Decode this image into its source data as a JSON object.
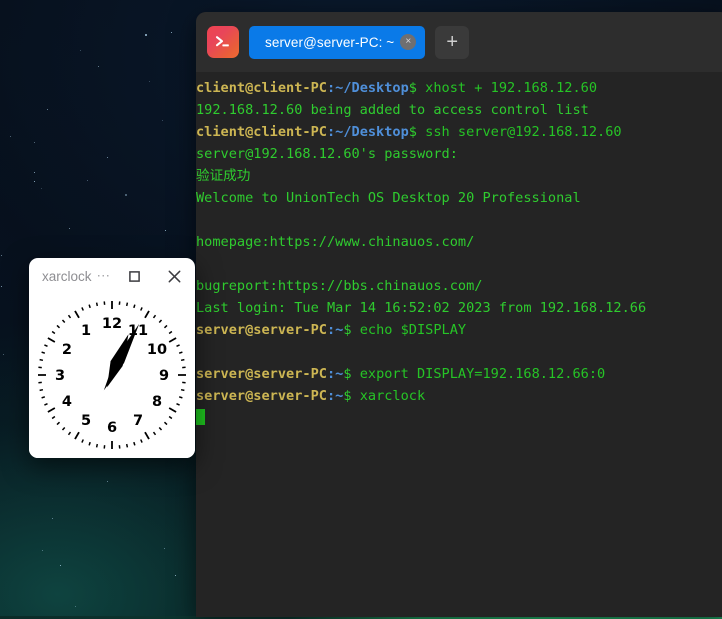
{
  "desktop": {
    "wallpaper_name": "starfield-wallpaper",
    "background_color": "#07121f",
    "accent_bottom_color": "#24b86c"
  },
  "terminal": {
    "window_name": "deepin-terminal",
    "app_icon": "terminal-prompt-icon",
    "tabbar_color": "#2d2d2d",
    "body_color": "#242424",
    "tab": {
      "label": "server@server-PC: ~",
      "close_label": "×",
      "active_color": "#0a7ae8"
    },
    "new_tab_label": "+",
    "prompt_user_color": "#cdb653",
    "text_color": "#2fcc2f",
    "lines": [
      {
        "type": "prompt",
        "user": "client@client-PC",
        "sep": ":",
        "path": "~/Desktop",
        "dollar": "$",
        "command": " xhost + 192.168.12.60"
      },
      {
        "type": "output",
        "text": "192.168.12.60 being added to access control list"
      },
      {
        "type": "prompt",
        "user": "client@client-PC",
        "sep": ":",
        "path": "~/Desktop",
        "dollar": "$",
        "command": " ssh server@192.168.12.60"
      },
      {
        "type": "output",
        "text": "server@192.168.12.60's password:"
      },
      {
        "type": "output",
        "text": "验证成功"
      },
      {
        "type": "output",
        "text": "Welcome to UnionTech OS Desktop 20 Professional"
      },
      {
        "type": "output",
        "text": ""
      },
      {
        "type": "output",
        "text": "homepage:https://www.chinauos.com/"
      },
      {
        "type": "output",
        "text": ""
      },
      {
        "type": "output",
        "text": "bugreport:https://bbs.chinauos.com/"
      },
      {
        "type": "output",
        "text": "Last login: Tue Mar 14 16:52:02 2023 from 192.168.12.66"
      },
      {
        "type": "prompt",
        "user": "server@server-PC",
        "sep": ":",
        "path": "~",
        "dollar": "$",
        "command": " echo $DISPLAY"
      },
      {
        "type": "output",
        "text": ""
      },
      {
        "type": "prompt",
        "user": "server@server-PC",
        "sep": ":",
        "path": "~",
        "dollar": "$",
        "command": " export DISPLAY=192.168.12.66:0"
      },
      {
        "type": "prompt",
        "user": "server@server-PC",
        "sep": ":",
        "path": "~",
        "dollar": "$",
        "command": " xarclock"
      },
      {
        "type": "cursor",
        "text": ""
      }
    ]
  },
  "clock_window": {
    "title": "xarclock",
    "menu_label": "⋯",
    "maximize_label": "maximize",
    "close_label": "✕",
    "face": {
      "style": "mirrored-analog-clock",
      "numerals": [
        "12",
        "1",
        "2",
        "3",
        "4",
        "5",
        "6",
        "7",
        "8",
        "9",
        "10",
        "11"
      ],
      "numeral_order": "counter-clockwise",
      "hour_hand_angle_deg": 22,
      "minute_hand_angle_deg": 28,
      "hand_color": "#000000",
      "face_color": "#ffffff"
    }
  }
}
